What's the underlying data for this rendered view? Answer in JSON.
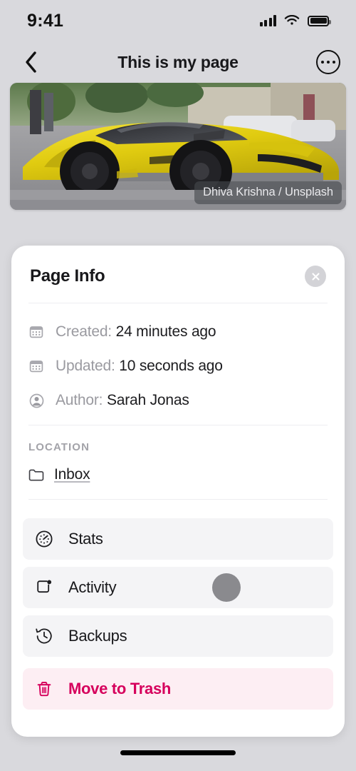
{
  "status_bar": {
    "time": "9:41",
    "signal_icon": "cellular-signal-icon",
    "wifi_icon": "wifi-icon",
    "battery_icon": "battery-full-icon"
  },
  "nav_bar": {
    "back_icon": "chevron-left-icon",
    "title": "This is my page",
    "more_icon": "ellipsis-circle-icon"
  },
  "hero": {
    "alt": "yellow-sports-car-photo",
    "credit": "Dhiva Krishna / Unsplash"
  },
  "card": {
    "title": "Page Info",
    "close_icon": "close-icon",
    "meta": [
      {
        "icon": "calendar-icon",
        "label": "Created:",
        "value": "24 minutes ago"
      },
      {
        "icon": "calendar-icon",
        "label": "Updated:",
        "value": "10 seconds ago"
      },
      {
        "icon": "person-circle-icon",
        "label": "Author:",
        "value": "Sarah Jonas"
      }
    ],
    "location": {
      "section_label": "LOCATION",
      "icon": "folder-icon",
      "value": "Inbox"
    },
    "menu": [
      {
        "icon": "gauge-icon",
        "label": "Stats",
        "danger": false
      },
      {
        "icon": "activity-badge-icon",
        "label": "Activity",
        "danger": false
      },
      {
        "icon": "clock-history-icon",
        "label": "Backups",
        "danger": false
      },
      {
        "icon": "trash-icon",
        "label": "Move to Trash",
        "danger": true
      }
    ]
  },
  "colors": {
    "background": "#d9d9dd",
    "card": "#ffffff",
    "row": "#f4f4f6",
    "danger_text": "#d6005c",
    "danger_bg": "#fdeef3",
    "label_gray": "#9a9aa0",
    "text_dark": "#18181b"
  },
  "overlay": {
    "touch_indicator": "touch-pointer-dot"
  },
  "home_indicator": "home-indicator-bar"
}
